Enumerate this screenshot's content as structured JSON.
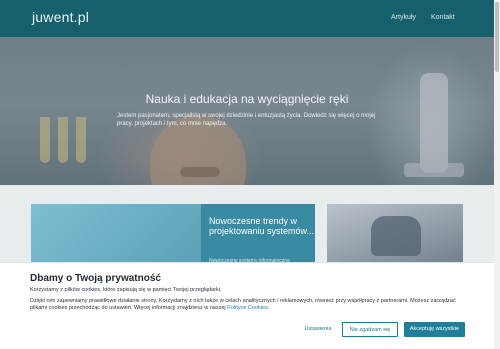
{
  "header": {
    "logo": "juwent.pl",
    "nav": [
      "Artykuły",
      "Kontakt"
    ]
  },
  "hero": {
    "title": "Nauka i edukacja na wyciągnięcie ręki",
    "subtitle": "Jestem pasjonatem, specjalistą w swojej dziedzinie i entuzjastą życia. Dowiedz się więcej o mojej pracy, projektach i tym, co mnie napędza."
  },
  "cards": [
    {
      "title": "Nowoczesne trendy w projektowaniu systemów...",
      "subtitle": "Nowoczesne systemy informatyczne wymagają..."
    }
  ],
  "cookie": {
    "title": "Dbamy o Twoją prywatność",
    "line1": "Korzystamy z plików cookies, które zapisują się w pamięci Twojej przeglądarki.",
    "line2": "Dzięki nim zapewniamy prawidłowe działanie strony. Korzystamy z nich także w celach analitycznych i reklamowych, również przy współpracy z partnerami. Możesz zarządzać plikami cookies przechodząc do ustawień. Więcej informacji znajdziesz w naszej",
    "policy_link": "Polityce Cookies.",
    "buttons": {
      "settings": "Ustawienia",
      "reject": "Nie zgadzam się",
      "accept": "Akceptuję wszystkie"
    }
  },
  "colors": {
    "header_bg": "#16606e",
    "accent": "#1f7f99",
    "card_panel": "#3a8aa3"
  }
}
